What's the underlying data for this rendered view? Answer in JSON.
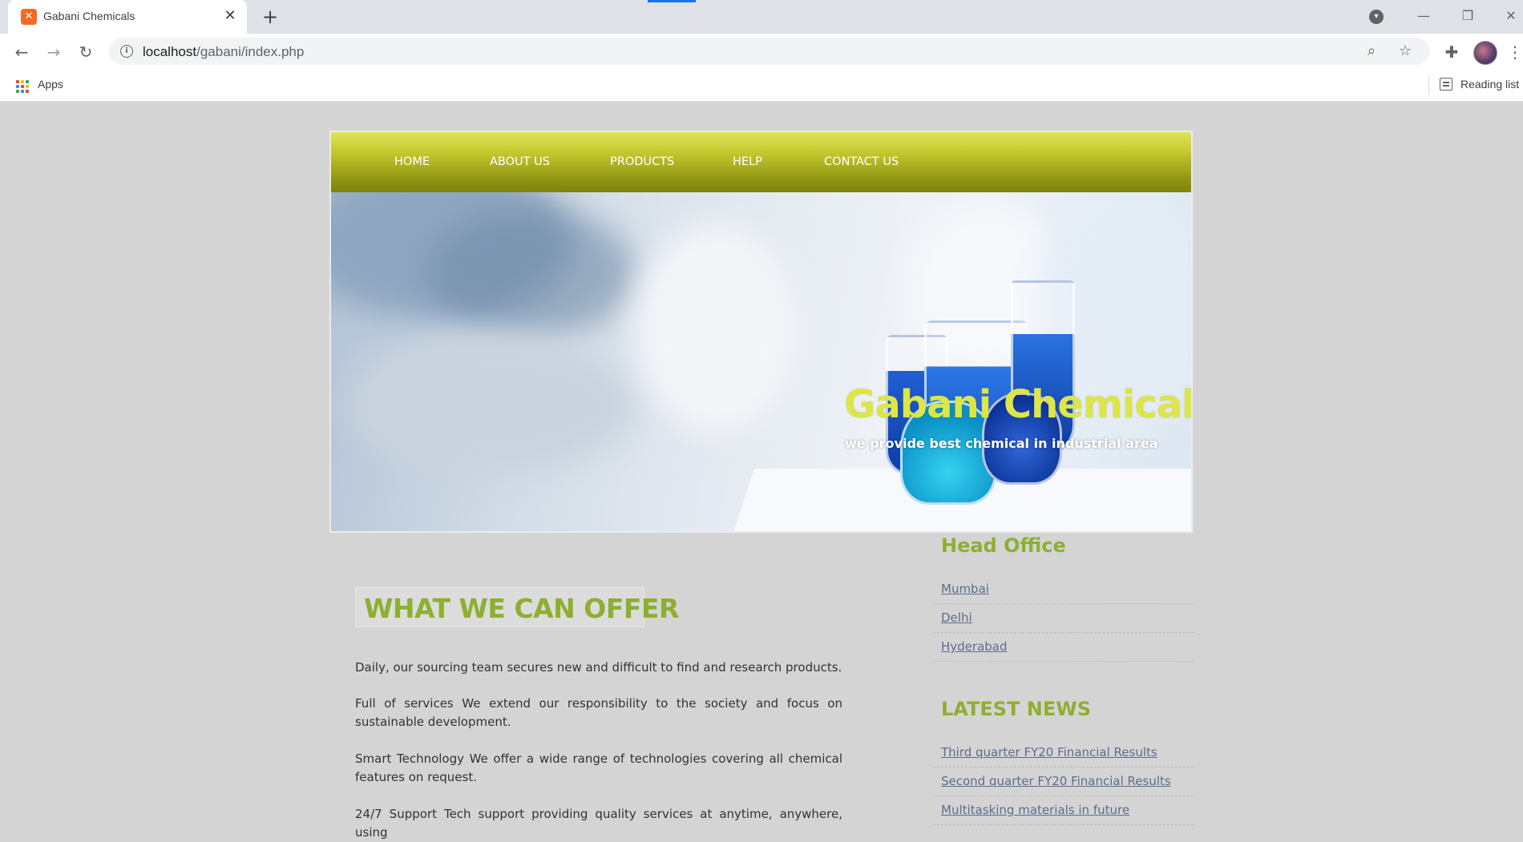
{
  "browser": {
    "tab_title": "Gabani Chemicals",
    "url_host": "localhost",
    "url_path": "/gabani/index.php",
    "bookmarks_apps": "Apps",
    "reading_list": "Reading list"
  },
  "nav": {
    "items": [
      "HOME",
      "ABOUT US",
      "PRODUCTS",
      "HELP",
      "CONTACT US"
    ]
  },
  "hero": {
    "title": "Gabani Chemicals",
    "subtitle": "we provide best chemical in industrial area"
  },
  "main": {
    "heading": "WHAT WE CAN OFFER",
    "paragraphs": [
      "Daily, our sourcing team secures new and difficult to find and research products.",
      "Full of services We extend our responsibility to the society and focus on sustainable development.",
      "Smart Technology We offer a wide range of technologies covering all chemical features on request.",
      "24/7 Support Tech support providing quality services at anytime, anywhere, using"
    ]
  },
  "sidebar": {
    "head_office_title": "Head Office",
    "offices": [
      "Mumbai",
      "Delhi",
      "Hyderabad"
    ],
    "news_title": "LATEST NEWS",
    "news": [
      "Third quarter FY20 Financial Results",
      "Second quarter FY20 Financial Results",
      "Multitasking materials in future"
    ]
  },
  "colors": {
    "accent_green": "#8eaf2f",
    "hero_title": "#dde548",
    "nav_gradient_top": "#dfe457",
    "nav_gradient_bottom": "#7e830d",
    "page_bg": "#d4d4d4"
  }
}
